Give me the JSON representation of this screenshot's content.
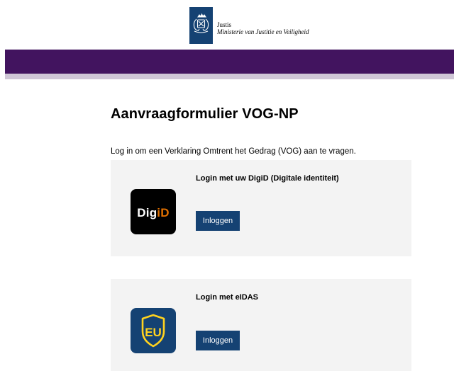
{
  "header": {
    "org_name": "Justis",
    "ministry_name": "Ministerie van Justitie en Veiligheid",
    "emblem_icon": "coat-of-arms-icon",
    "emblem_color": "#154273"
  },
  "banner": {
    "color": "#42145f"
  },
  "main": {
    "title": "Aanvraagformulier VOG-NP",
    "intro": "Log in om een Verklaring Omtrent het Gedrag (VOG) aan te vragen."
  },
  "login_options": [
    {
      "title": "Login met uw DigiD (Digitale identiteit)",
      "button_label": "Inloggen",
      "logo_icon": "digid-logo-icon",
      "logo_text_main": "Dig",
      "logo_text_accent": "iD"
    },
    {
      "title": "Login met eIDAS",
      "button_label": "Inloggen",
      "logo_icon": "eu-shield-icon",
      "logo_text": "EU"
    }
  ],
  "colors": {
    "button": "#154273",
    "card_background": "#f3f3f3",
    "digid_accent": "#e17000",
    "eu_shield": "#ffd21f"
  }
}
